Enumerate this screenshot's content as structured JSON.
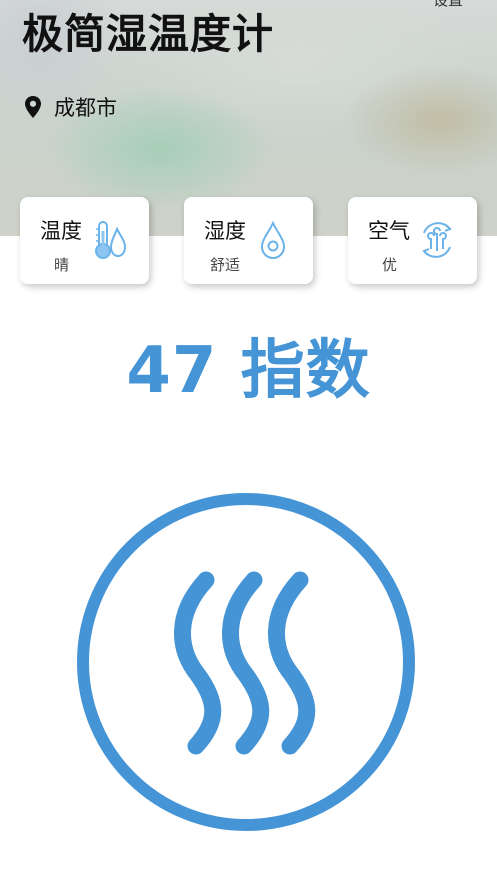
{
  "header": {
    "settings_label": "设置",
    "title": "极简湿温度计",
    "location_icon": "map-pin-icon",
    "location": "成都市"
  },
  "cards": [
    {
      "id": "temperature",
      "title": "温度",
      "status": "晴",
      "icon": "thermometer-drop-icon"
    },
    {
      "id": "humidity",
      "title": "湿度",
      "status": "舒适",
      "icon": "water-drop-icon"
    },
    {
      "id": "air",
      "title": "空气",
      "status": "优",
      "icon": "air-cycle-icon"
    }
  ],
  "index": {
    "value": "47",
    "label": "指数"
  },
  "main_icon": "humidity-waves-icon",
  "colors": {
    "accent": "#4594d6",
    "icon_light": "#6ab3ea"
  }
}
